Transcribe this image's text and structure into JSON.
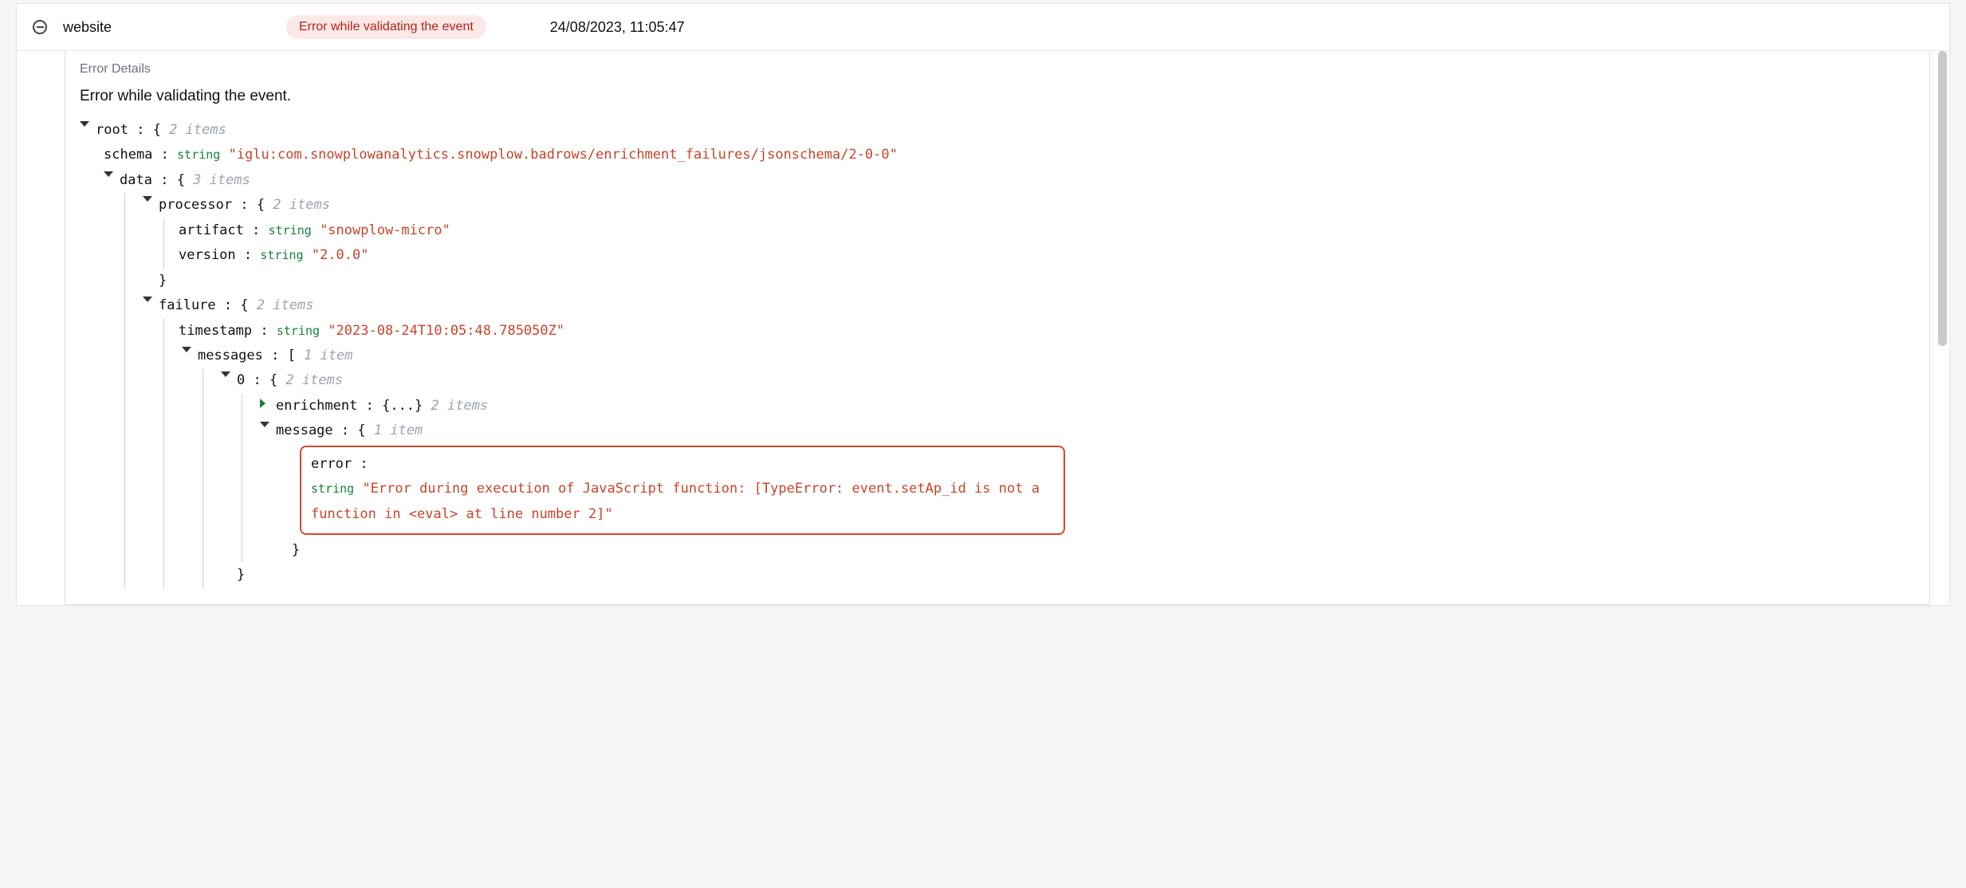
{
  "row": {
    "source": "website",
    "badge": "Error while validating the event",
    "timestamp": "24/08/2023, 11:05:47"
  },
  "details": {
    "header": "Error Details",
    "title": "Error while validating the event."
  },
  "tree": {
    "root": {
      "label": "root",
      "count": "2 items"
    },
    "schema": {
      "key": "schema",
      "type": "string",
      "value": "\"iglu:com.snowplowanalytics.snowplow.badrows/enrichment_failures/jsonschema/2-0-0\""
    },
    "data": {
      "key": "data",
      "count": "3 items"
    },
    "processor": {
      "key": "processor",
      "count": "2 items"
    },
    "artifact": {
      "key": "artifact",
      "type": "string",
      "value": "\"snowplow-micro\""
    },
    "version": {
      "key": "version",
      "type": "string",
      "value": "\"2.0.0\""
    },
    "failure": {
      "key": "failure",
      "count": "2 items"
    },
    "failure_timestamp": {
      "key": "timestamp",
      "type": "string",
      "value": "\"2023-08-24T10:05:48.785050Z\""
    },
    "messages": {
      "key": "messages",
      "count": "1 item"
    },
    "msg0": {
      "key": "0",
      "count": "2 items"
    },
    "enrichment": {
      "key": "enrichment",
      "collapsed": "{...}",
      "count": "2 items"
    },
    "message": {
      "key": "message",
      "count": "1 item"
    },
    "error": {
      "key": "error",
      "type": "string",
      "value": "\"Error during execution of JavaScript function: [TypeError: event.setAp_id is not a function in <eval> at line number 2]\""
    }
  }
}
